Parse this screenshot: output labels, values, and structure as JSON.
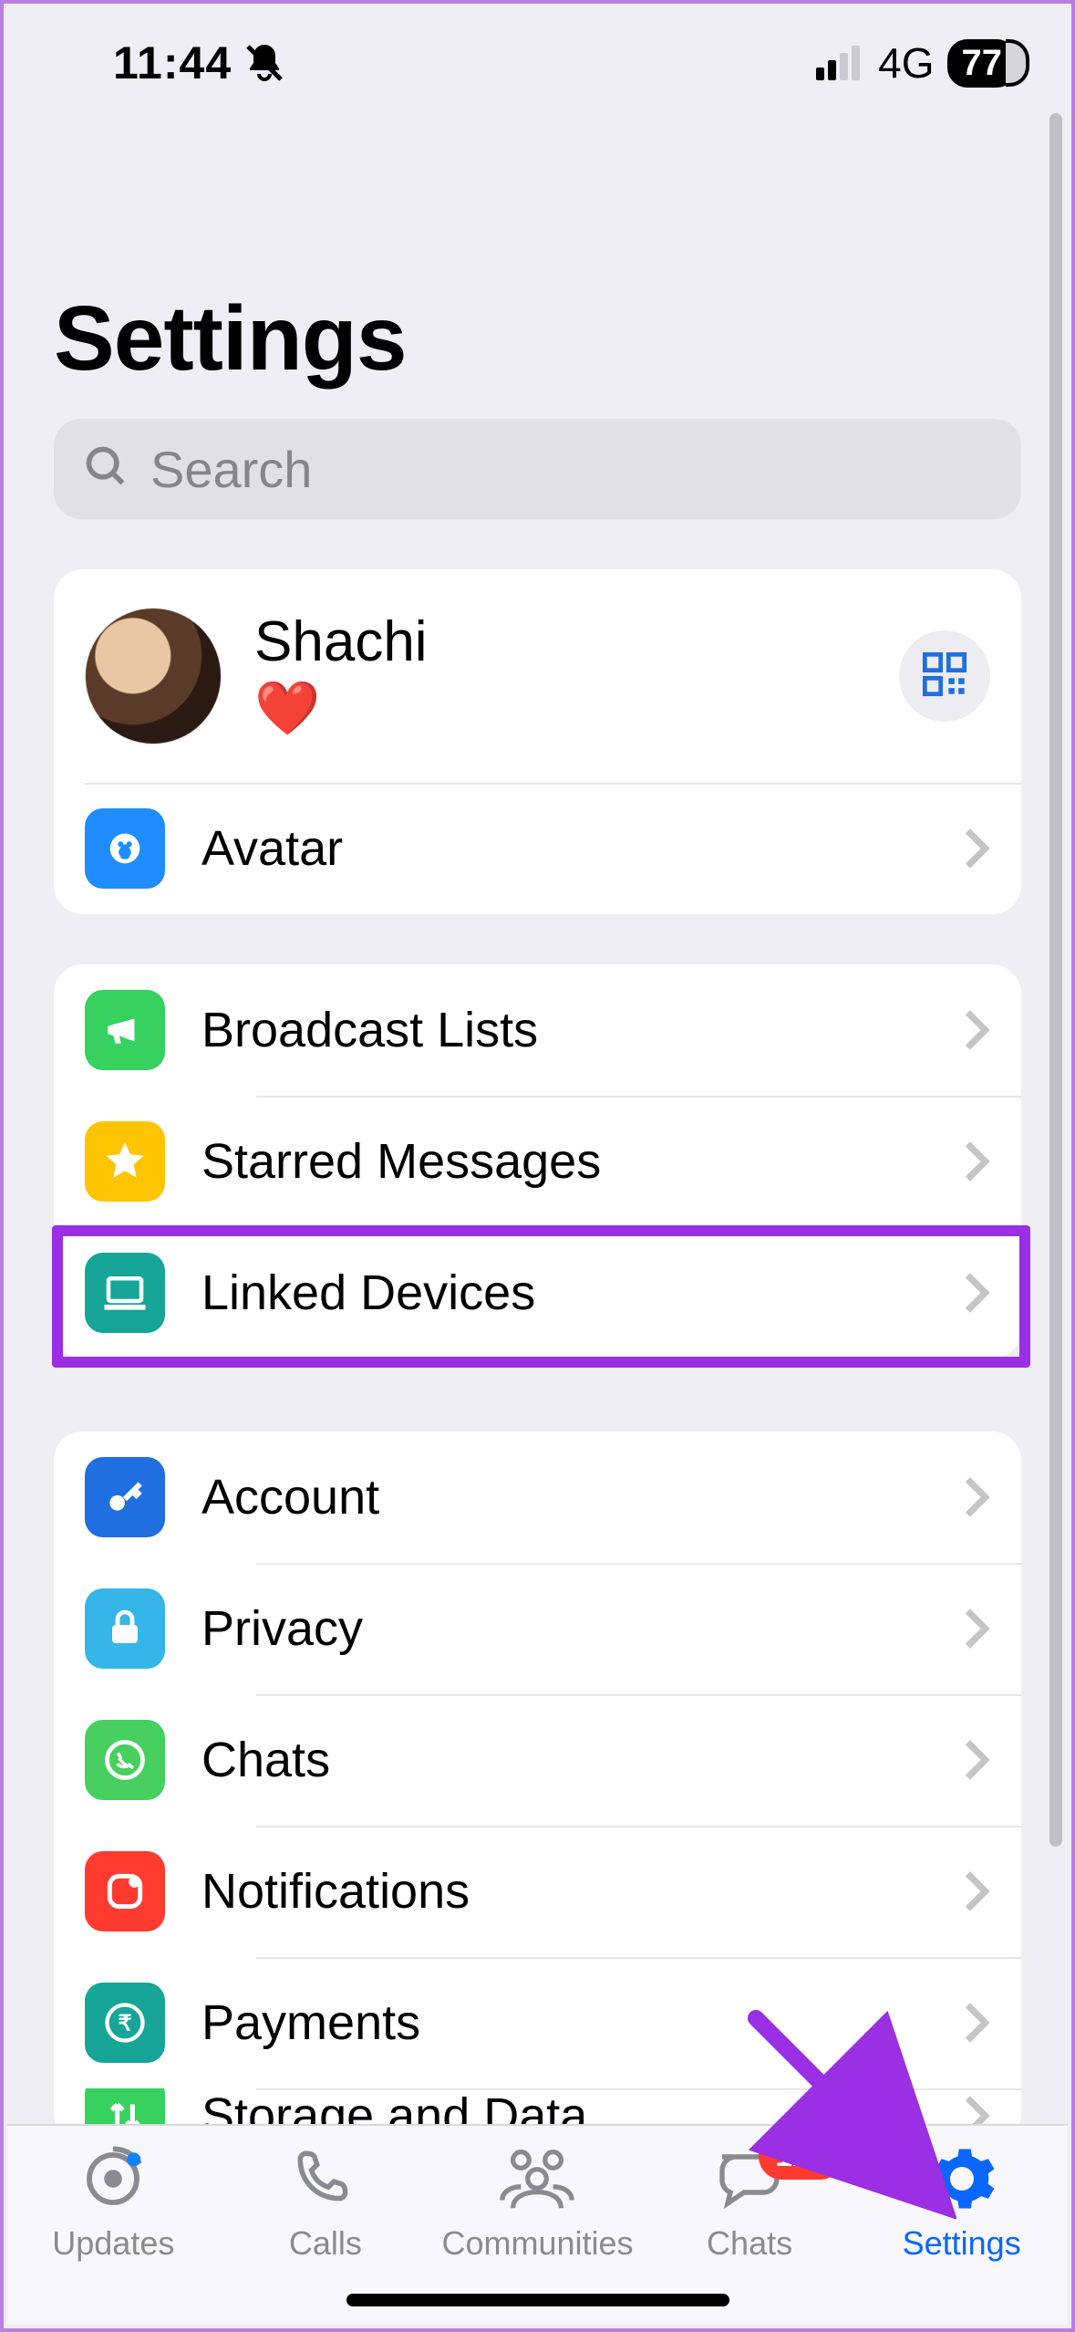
{
  "status": {
    "time": "11:44",
    "network_type": "4G",
    "battery_pct": "77"
  },
  "header": {
    "title": "Settings"
  },
  "search": {
    "placeholder": "Search"
  },
  "profile": {
    "name": "Shachi",
    "status": "❤️"
  },
  "section1": {
    "avatar": "Avatar"
  },
  "section2": {
    "broadcast": "Broadcast Lists",
    "starred": "Starred Messages",
    "linked": "Linked Devices"
  },
  "section3": {
    "account": "Account",
    "privacy": "Privacy",
    "chats": "Chats",
    "notifications": "Notifications",
    "payments": "Payments",
    "storage": "Storage and Data"
  },
  "tabs": {
    "updates": "Updates",
    "calls": "Calls",
    "communities": "Communities",
    "chats": "Chats",
    "chats_badge": "124",
    "settings": "Settings"
  },
  "icons": {
    "avatar": "avatar-icon",
    "broadcast": "megaphone-icon",
    "starred": "star-icon",
    "linked": "laptop-icon",
    "account": "key-icon",
    "privacy": "lock-icon",
    "chats": "whatsapp-icon",
    "notifications": "notification-icon",
    "payments": "rupee-icon",
    "storage": "arrows-icon"
  },
  "colors": {
    "avatar": "#1f8cff",
    "broadcast": "#37d160",
    "starred": "#ffc400",
    "linked": "#16a597",
    "account": "#1f6fe0",
    "privacy": "#35b5e8",
    "chats": "#47cf5f",
    "notifications": "#ff3b30",
    "payments": "#16a597",
    "storage": "#37d160"
  }
}
